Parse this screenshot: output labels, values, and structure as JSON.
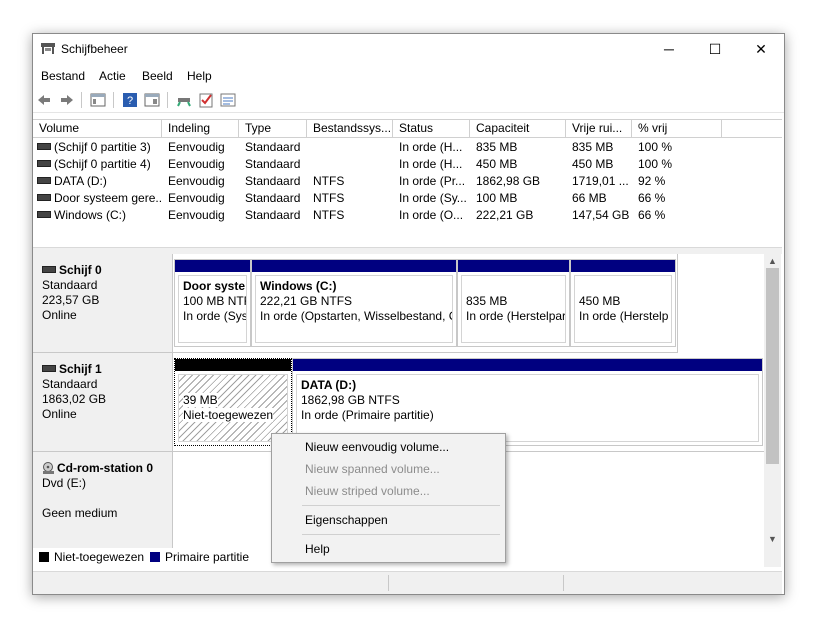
{
  "window": {
    "title": "Schijfbeheer",
    "controls": {
      "minimize": "─",
      "maximize": "☐",
      "close": "✕"
    }
  },
  "menu": [
    "Bestand",
    "Actie",
    "Beeld",
    "Help"
  ],
  "columns": [
    "Volume",
    "Indeling",
    "Type",
    "Bestandssys...",
    "Status",
    "Capaciteit",
    "Vrije rui...",
    "% vrij"
  ],
  "volumes": [
    [
      "(Schijf 0 partitie 3)",
      "Eenvoudig",
      "Standaard",
      "",
      "In orde (H...",
      "835 MB",
      "835 MB",
      "100 %"
    ],
    [
      "(Schijf 0 partitie 4)",
      "Eenvoudig",
      "Standaard",
      "",
      "In orde (H...",
      "450 MB",
      "450 MB",
      "100 %"
    ],
    [
      "DATA (D:)",
      "Eenvoudig",
      "Standaard",
      "NTFS",
      "In orde (Pr...",
      "1862,98 GB",
      "1719,01 ...",
      "92 %"
    ],
    [
      "Door systeem gere...",
      "Eenvoudig",
      "Standaard",
      "NTFS",
      "In orde (Sy...",
      "100 MB",
      "66 MB",
      "66 %"
    ],
    [
      "Windows (C:)",
      "Eenvoudig",
      "Standaard",
      "NTFS",
      "In orde (O...",
      "222,21 GB",
      "147,54 GB",
      "66 %"
    ]
  ],
  "disks": {
    "disk0": {
      "name": "Schijf 0",
      "type": "Standaard",
      "size": "223,57 GB",
      "state": "Online",
      "partitions": [
        {
          "title": "Door syste",
          "size": "100 MB NTF",
          "status": "In orde (Sys"
        },
        {
          "title": "Windows  (C:)",
          "size": "222,21 GB NTFS",
          "status": "In orde (Opstarten, Wisselbestand, C"
        },
        {
          "title": "",
          "size": "835 MB",
          "status": "In orde (Herstelpar"
        },
        {
          "title": "",
          "size": "450 MB",
          "status": "In orde (Herstelp"
        }
      ]
    },
    "disk1": {
      "name": "Schijf 1",
      "type": "Standaard",
      "size": "1863,02 GB",
      "state": "Online",
      "unallocated": {
        "size": "39 MB",
        "status": "Niet-toegewezen"
      },
      "data": {
        "title": "DATA  (D:)",
        "size": "1862,98 GB NTFS",
        "status": "In orde (Primaire partitie)"
      }
    },
    "cdrom": {
      "name": "Cd-rom-station 0",
      "drive": "Dvd (E:)",
      "state": "Geen medium"
    }
  },
  "legend": {
    "unallocated": "Niet-toegewezen",
    "primary": "Primaire partitie"
  },
  "context_menu": {
    "new_simple": "Nieuw eenvoudig volume...",
    "new_spanned": "Nieuw spanned volume...",
    "new_striped": "Nieuw striped volume...",
    "properties": "Eigenschappen",
    "help": "Help"
  },
  "colors": {
    "primary": "#000080",
    "unallocated": "#000000"
  }
}
